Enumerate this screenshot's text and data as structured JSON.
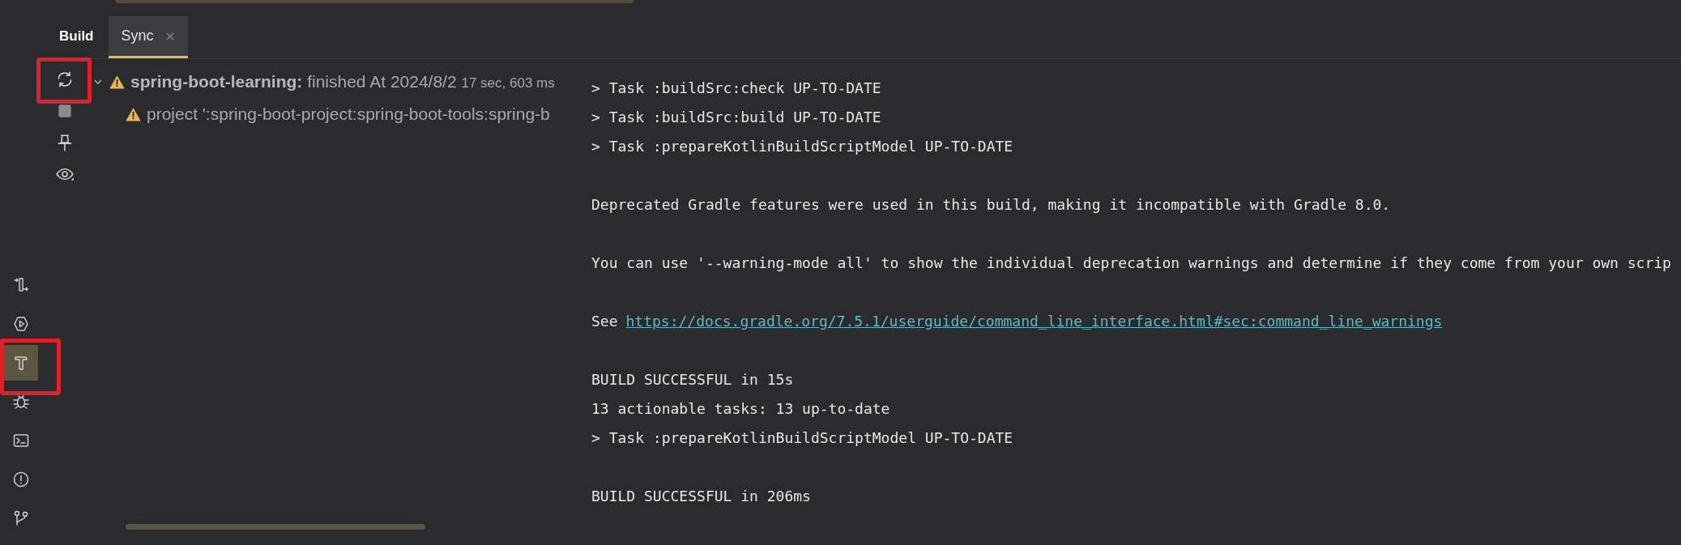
{
  "tool_strip": [
    {
      "kind": "deploy",
      "selected": false
    },
    {
      "kind": "run",
      "selected": false
    },
    {
      "kind": "build",
      "selected": true
    },
    {
      "kind": "debug",
      "selected": false
    },
    {
      "kind": "terminal",
      "selected": false
    },
    {
      "kind": "problems",
      "selected": false
    },
    {
      "kind": "git",
      "selected": false
    }
  ],
  "tabs": [
    {
      "label": "Build",
      "selected": false,
      "closable": false
    },
    {
      "label": "Sync",
      "selected": true,
      "closable": true
    }
  ],
  "build_toolbar": [
    {
      "kind": "sync"
    },
    {
      "kind": "stop"
    },
    {
      "kind": "pin"
    },
    {
      "kind": "view"
    }
  ],
  "tree": [
    {
      "name": "spring-boot-learning:",
      "status": "finished At 2024/8/2",
      "duration": "17 sec, 603 ms",
      "warning": true,
      "expanded": true,
      "children": [
        {
          "text": "project ':spring-boot-project:spring-boot-tools:spring-b",
          "warning": true
        }
      ]
    }
  ],
  "console": [
    {
      "kind": "text",
      "text": "> Task :buildSrc:check UP-TO-DATE"
    },
    {
      "kind": "text",
      "text": "> Task :buildSrc:build UP-TO-DATE"
    },
    {
      "kind": "text",
      "text": "> Task :prepareKotlinBuildScriptModel UP-TO-DATE"
    },
    {
      "kind": "blank"
    },
    {
      "kind": "text",
      "text": "Deprecated Gradle features were used in this build, making it incompatible with Gradle 8.0."
    },
    {
      "kind": "blank"
    },
    {
      "kind": "text",
      "text": "You can use '--warning-mode all' to show the individual deprecation warnings and determine if they come from your own scrip"
    },
    {
      "kind": "blank"
    },
    {
      "kind": "link",
      "text": "See",
      "url": "https://docs.gradle.org/7.5.1/userguide/command_line_interface.html#sec:command_line_warnings"
    },
    {
      "kind": "blank"
    },
    {
      "kind": "text",
      "text": "BUILD SUCCESSFUL in 15s"
    },
    {
      "kind": "text",
      "text": "13 actionable tasks: 13 up-to-date"
    },
    {
      "kind": "text",
      "text": "> Task :prepareKotlinBuildScriptModel UP-TO-DATE"
    },
    {
      "kind": "blank"
    },
    {
      "kind": "text",
      "text": "BUILD SUCCESSFUL in 206ms"
    }
  ]
}
